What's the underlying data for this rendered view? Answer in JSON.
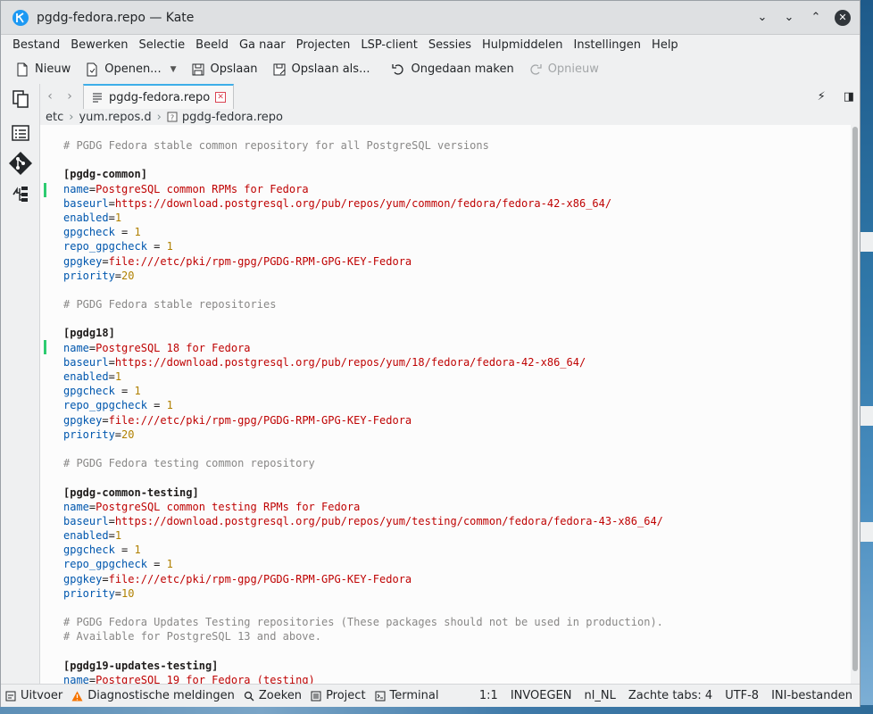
{
  "window": {
    "title": "pgdg-fedora.repo — Kate"
  },
  "menu": [
    "Bestand",
    "Bewerken",
    "Selectie",
    "Beeld",
    "Ga naar",
    "Projecten",
    "LSP-client",
    "Sessies",
    "Hulpmiddelen",
    "Instellingen",
    "Help"
  ],
  "toolbar": {
    "new": "Nieuw",
    "open": "Openen...",
    "save": "Opslaan",
    "save_as": "Opslaan als...",
    "undo": "Ongedaan maken",
    "redo": "Opnieuw"
  },
  "tab": {
    "label": "pgdg-fedora.repo"
  },
  "breadcrumb": [
    "etc",
    "yum.repos.d",
    "pgdg-fedora.repo"
  ],
  "code_lines": [
    [
      [
        "comment",
        "# PGDG Fedora stable common repository for all PostgreSQL versions"
      ]
    ],
    [],
    [
      [
        "section",
        "[pgdg-common]"
      ]
    ],
    [
      [
        "key",
        "name"
      ],
      [
        "eq",
        "="
      ],
      [
        "val",
        "PostgreSQL common RPMs for Fedora"
      ]
    ],
    [
      [
        "key",
        "baseurl"
      ],
      [
        "eq",
        "="
      ],
      [
        "val",
        "https://download.postgresql.org/pub/repos/yum/common/fedora/fedora-42-x86_64/"
      ]
    ],
    [
      [
        "key",
        "enabled"
      ],
      [
        "eq",
        "="
      ],
      [
        "num",
        "1"
      ]
    ],
    [
      [
        "key",
        "gpgcheck"
      ],
      [
        "eq",
        " = "
      ],
      [
        "num",
        "1"
      ]
    ],
    [
      [
        "key",
        "repo_gpgcheck"
      ],
      [
        "eq",
        " = "
      ],
      [
        "num",
        "1"
      ]
    ],
    [
      [
        "key",
        "gpgkey"
      ],
      [
        "eq",
        "="
      ],
      [
        "val",
        "file:///etc/pki/rpm-gpg/PGDG-RPM-GPG-KEY-Fedora"
      ]
    ],
    [
      [
        "key",
        "priority"
      ],
      [
        "eq",
        "="
      ],
      [
        "num",
        "20"
      ]
    ],
    [],
    [
      [
        "comment",
        "# PGDG Fedora stable repositories"
      ]
    ],
    [],
    [
      [
        "section",
        "[pgdg18]"
      ]
    ],
    [
      [
        "key",
        "name"
      ],
      [
        "eq",
        "="
      ],
      [
        "val",
        "PostgreSQL 18 for Fedora"
      ]
    ],
    [
      [
        "key",
        "baseurl"
      ],
      [
        "eq",
        "="
      ],
      [
        "val",
        "https://download.postgresql.org/pub/repos/yum/18/fedora/fedora-42-x86_64/"
      ]
    ],
    [
      [
        "key",
        "enabled"
      ],
      [
        "eq",
        "="
      ],
      [
        "num",
        "1"
      ]
    ],
    [
      [
        "key",
        "gpgcheck"
      ],
      [
        "eq",
        " = "
      ],
      [
        "num",
        "1"
      ]
    ],
    [
      [
        "key",
        "repo_gpgcheck"
      ],
      [
        "eq",
        " = "
      ],
      [
        "num",
        "1"
      ]
    ],
    [
      [
        "key",
        "gpgkey"
      ],
      [
        "eq",
        "="
      ],
      [
        "val",
        "file:///etc/pki/rpm-gpg/PGDG-RPM-GPG-KEY-Fedora"
      ]
    ],
    [
      [
        "key",
        "priority"
      ],
      [
        "eq",
        "="
      ],
      [
        "num",
        "20"
      ]
    ],
    [],
    [
      [
        "comment",
        "# PGDG Fedora testing common repository"
      ]
    ],
    [],
    [
      [
        "section",
        "[pgdg-common-testing]"
      ]
    ],
    [
      [
        "key",
        "name"
      ],
      [
        "eq",
        "="
      ],
      [
        "val",
        "PostgreSQL common testing RPMs for Fedora"
      ]
    ],
    [
      [
        "key",
        "baseurl"
      ],
      [
        "eq",
        "="
      ],
      [
        "val",
        "https://download.postgresql.org/pub/repos/yum/testing/common/fedora/fedora-43-x86_64/"
      ]
    ],
    [
      [
        "key",
        "enabled"
      ],
      [
        "eq",
        "="
      ],
      [
        "num",
        "1"
      ]
    ],
    [
      [
        "key",
        "gpgcheck"
      ],
      [
        "eq",
        " = "
      ],
      [
        "num",
        "1"
      ]
    ],
    [
      [
        "key",
        "repo_gpgcheck"
      ],
      [
        "eq",
        " = "
      ],
      [
        "num",
        "1"
      ]
    ],
    [
      [
        "key",
        "gpgkey"
      ],
      [
        "eq",
        "="
      ],
      [
        "val",
        "file:///etc/pki/rpm-gpg/PGDG-RPM-GPG-KEY-Fedora"
      ]
    ],
    [
      [
        "key",
        "priority"
      ],
      [
        "eq",
        "="
      ],
      [
        "num",
        "10"
      ]
    ],
    [],
    [
      [
        "comment",
        "# PGDG Fedora Updates Testing repositories (These packages should not be used in production)."
      ]
    ],
    [
      [
        "comment",
        "# Available for PostgreSQL 13 and above."
      ]
    ],
    [],
    [
      [
        "section",
        "[pgdg19-updates-testing]"
      ]
    ],
    [
      [
        "key",
        "name"
      ],
      [
        "eq",
        "="
      ],
      [
        "val",
        "PostgreSQL 19 for Fedora (testing)"
      ]
    ]
  ],
  "statusbar": {
    "output": "Uitvoer",
    "diagnostics": "Diagnostische meldingen",
    "search": "Zoeken",
    "project": "Project",
    "terminal": "Terminal",
    "cursor": "1:1",
    "mode": "INVOEGEN",
    "locale": "nl_NL",
    "indent": "Zachte tabs: 4",
    "encoding": "UTF-8",
    "filetype": "INI-bestanden"
  },
  "colors": {
    "accent": "#3daee9",
    "comment": "#898887",
    "key": "#0057ae",
    "value": "#bf0303",
    "number": "#b08000",
    "modified": "#2ecc71"
  }
}
